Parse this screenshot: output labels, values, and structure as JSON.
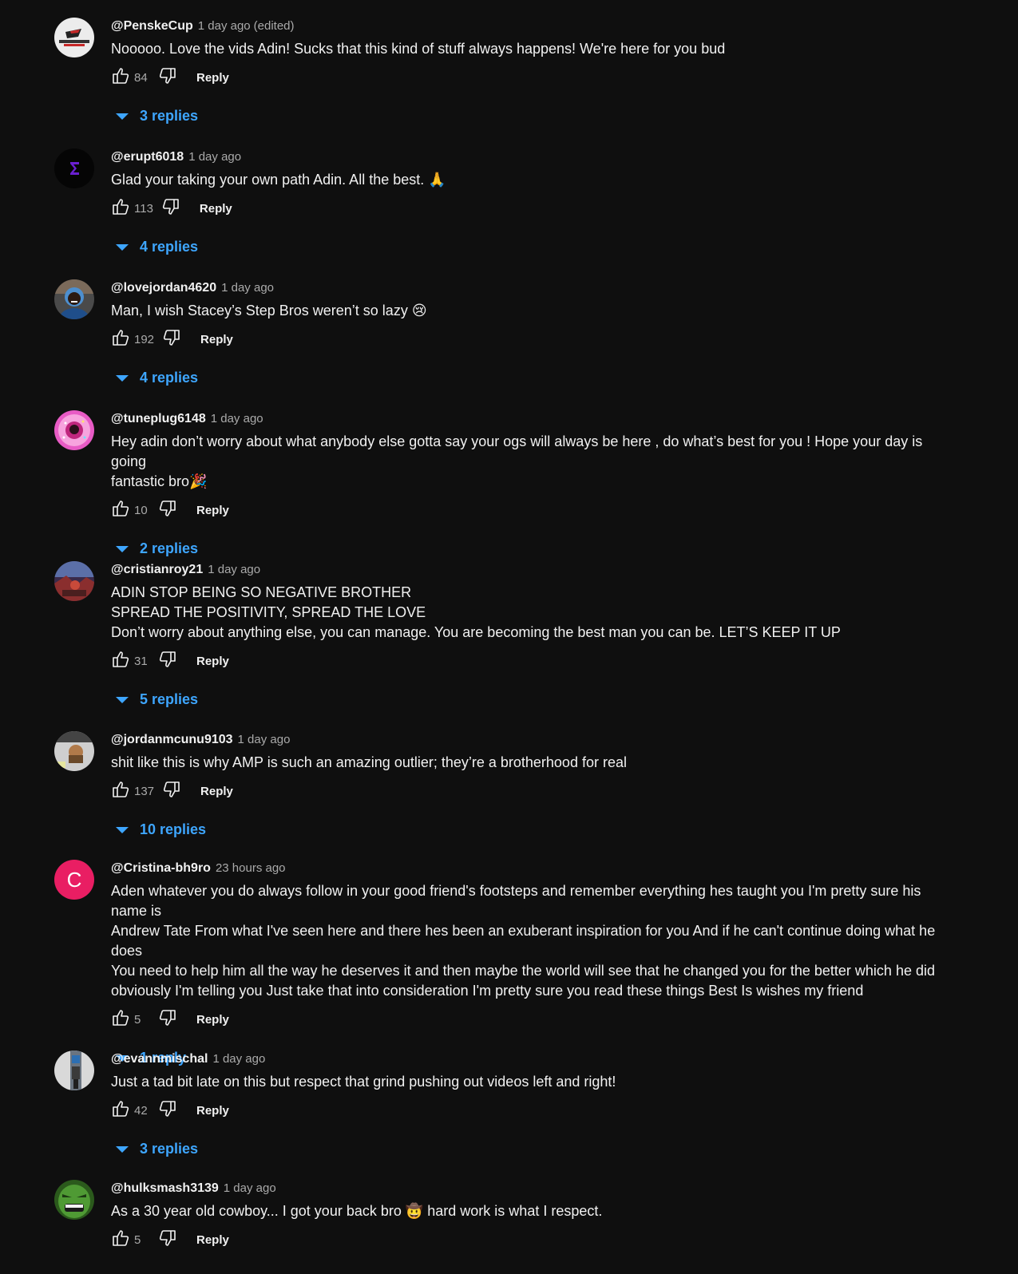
{
  "comments": [
    {
      "author": "@PenskeCup",
      "time": "1 day ago",
      "edited": "(edited)",
      "lines": [
        "Nooooo. Love the vids Adin! Sucks that this kind of stuff always happens! We're here for you bud"
      ],
      "likes": "84",
      "reply_label": "Reply",
      "replies": "3 replies",
      "avatar": "penske-logo",
      "avatar_color": "#e8e8e8"
    },
    {
      "author": "@erupt6018",
      "time": "1 day ago",
      "lines": [
        "Glad your taking your own path Adin. All the best. 🙏"
      ],
      "likes": "113",
      "reply_label": "Reply",
      "replies": "4 replies",
      "avatar": "sigma-logo",
      "avatar_color": "#050505"
    },
    {
      "author": "@lovejordan4620",
      "time": "1 day ago",
      "lines": [
        "Man, I wish Stacey’s Step Bros weren’t so lazy 😢"
      ],
      "likes": "192",
      "reply_label": "Reply",
      "replies": "4 replies",
      "avatar": "person-photo",
      "avatar_color": "#3b3b3b"
    },
    {
      "author": "@tuneplug6148",
      "time": "1 day ago",
      "lines": [
        "Hey adin don’t worry about what anybody else gotta say your ogs will always be here , do what’s best for you ! Hope your day is going",
        "fantastic bro🎉"
      ],
      "likes": "10",
      "reply_label": "Reply",
      "replies": "2 replies",
      "avatar": "pink-donut",
      "avatar_color": "#e85bc5"
    },
    {
      "author": "@cristianroy21",
      "time": "1 day ago",
      "lines": [
        "ADIN STOP BEING SO NEGATIVE BROTHER",
        "SPREAD THE POSITIVITY, SPREAD THE LOVE",
        "Don’t worry about anything else, you can manage. You are becoming the best man you can be. LET’S KEEP IT UP"
      ],
      "likes": "31",
      "reply_label": "Reply",
      "replies": "5 replies",
      "avatar": "red-scene",
      "avatar_color": "#5a2a3a"
    },
    {
      "author": "@jordanmcunu9103",
      "time": "1 day ago",
      "lines": [
        "shit like this is why AMP is such an amazing outlier; they’re a brotherhood for real"
      ],
      "likes": "137",
      "reply_label": "Reply",
      "replies": "10 replies",
      "avatar": "photo-collage",
      "avatar_color": "#8a8a8a"
    },
    {
      "author": "@Cristina-bh9ro",
      "time": "23 hours ago",
      "lines": [
        "Aden whatever you do always follow in your good friend's footsteps and remember everything hes taught you I'm pretty sure his name is",
        "Andrew Tate From what I've seen here and there hes been an exuberant inspiration for you And if he can't continue doing what he does",
        "You need to help him all the way he deserves it and then maybe the world will see that he changed you for the better which he did",
        "obviously I'm telling you Just take that into consideration I'm pretty sure you read these things Best Is wishes my friend"
      ],
      "likes": "5",
      "reply_label": "Reply",
      "replies": "1 reply",
      "avatar": "letter",
      "avatar_letter": "C",
      "avatar_color": "#e91e63"
    },
    {
      "author": "@evannmischal",
      "time": "1 day ago",
      "lines": [
        "Just a tad bit late on this but respect that grind pushing out videos left and right!"
      ],
      "likes": "42",
      "reply_label": "Reply",
      "replies": "3 replies",
      "avatar": "mirror-selfie",
      "avatar_color": "#7a7f86"
    },
    {
      "author": "@hulksmash3139",
      "time": "1 day ago",
      "lines": [
        "As a 30 year old cowboy... I got your back bro 🤠 hard work is what I respect."
      ],
      "likes": "5",
      "reply_label": "Reply",
      "avatar": "hulk-face",
      "avatar_color": "#3f7a2a"
    }
  ]
}
